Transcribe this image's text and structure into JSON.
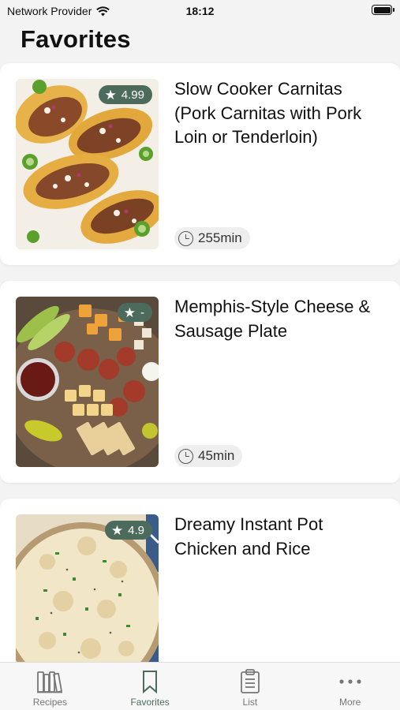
{
  "status_bar": {
    "carrier": "Network Provider",
    "time": "18:12"
  },
  "page": {
    "title": "Favorites"
  },
  "colors": {
    "accent": "#4d6b5c",
    "card": "#ffffff",
    "background": "#f3f3f3"
  },
  "recipes": [
    {
      "title": "Slow Cooker Carnitas (Pork Carnitas with Pork Loin or Tenderloin)",
      "rating": "4.99",
      "time": "255min",
      "image": "tacos-photo"
    },
    {
      "title": "Memphis-Style Cheese & Sausage Plate",
      "rating": "-",
      "time": "45min",
      "image": "cheese-sausage-plate-photo"
    },
    {
      "title": "Dreamy Instant Pot Chicken and Rice",
      "rating": "4.9",
      "time": "",
      "image": "chicken-rice-photo"
    }
  ],
  "tabs": [
    {
      "label": "Recipes",
      "icon": "books-icon"
    },
    {
      "label": "Favorites",
      "icon": "bookmark-icon",
      "active": true
    },
    {
      "label": "List",
      "icon": "clipboard-icon"
    },
    {
      "label": "More",
      "icon": "more-dots-icon"
    }
  ]
}
